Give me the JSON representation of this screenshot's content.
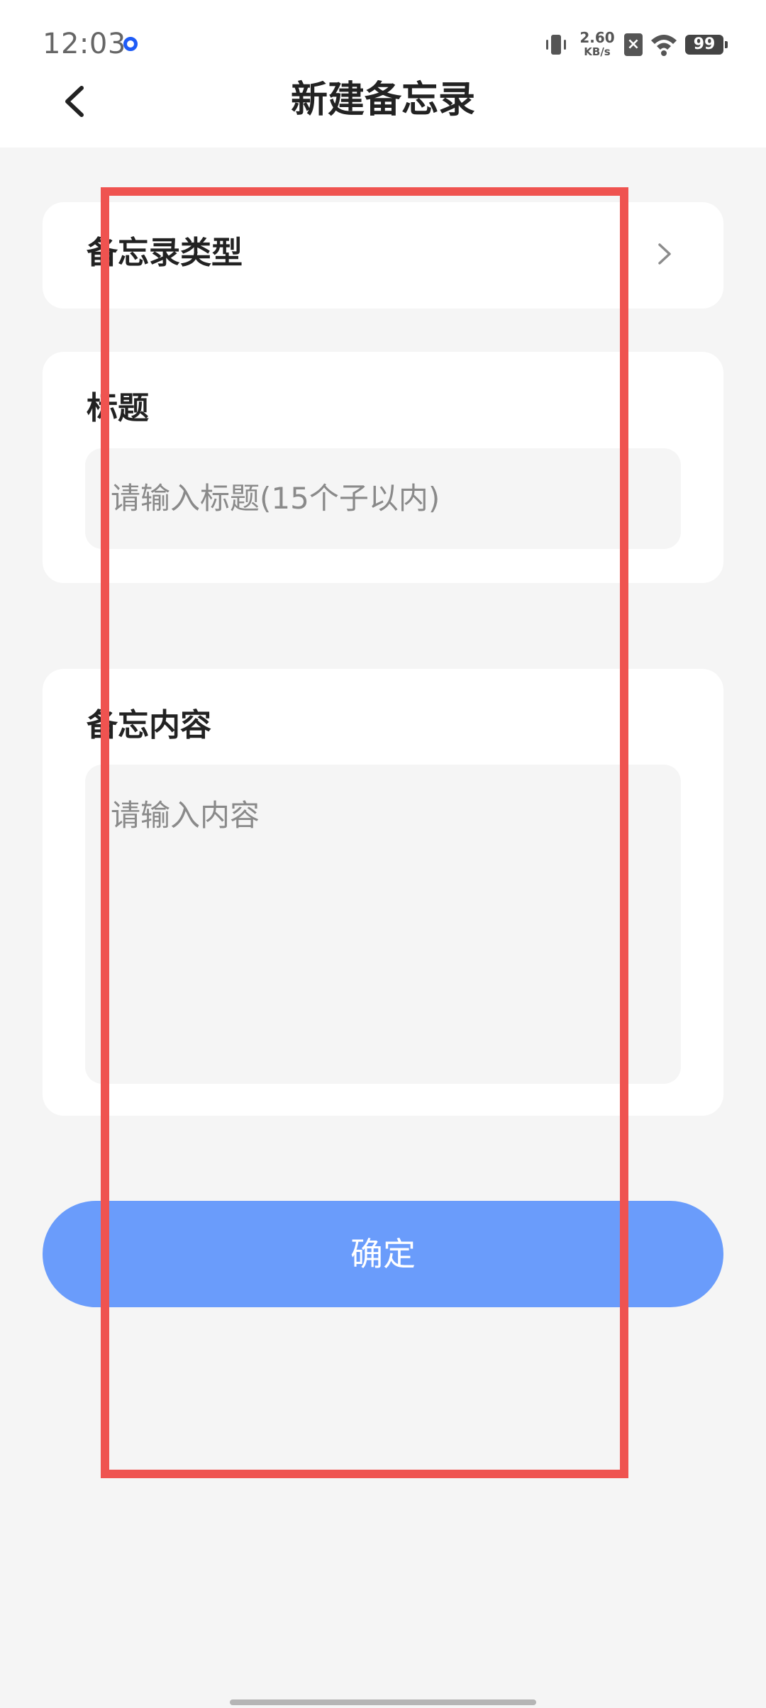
{
  "status_bar": {
    "time": "12:03",
    "net_speed_value": "2.60",
    "net_speed_unit": "KB/s",
    "battery": "99",
    "sim": "×"
  },
  "header": {
    "title": "新建备忘录"
  },
  "type_row": {
    "label": "备忘录类型"
  },
  "title_section": {
    "label": "标题",
    "placeholder": "请输入标题(15个子以内)",
    "value": ""
  },
  "content_section": {
    "label": "备忘内容",
    "placeholder": "请输入内容",
    "value": ""
  },
  "confirm_button": {
    "label": "确定"
  },
  "colors": {
    "accent": "#6a9cfb",
    "highlight": "#ef5350",
    "background": "#f5f5f5"
  }
}
